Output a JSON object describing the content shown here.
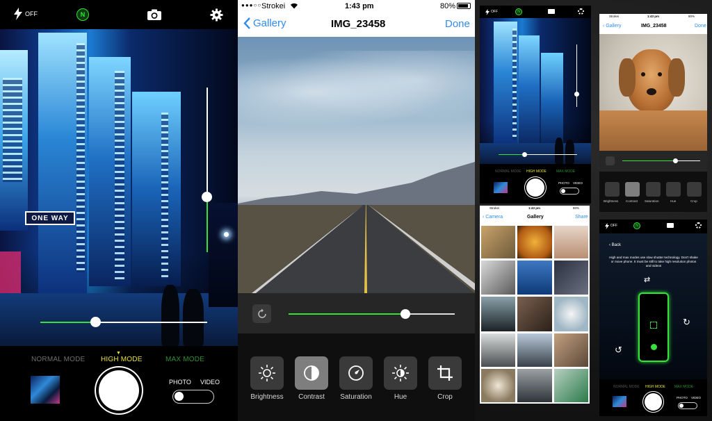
{
  "camera": {
    "flash_label": "OFF",
    "n_badge": "N",
    "modes": [
      "NORMAL MODE",
      "HIGH MODE",
      "MAX MODE"
    ],
    "active_mode": "HIGH MODE",
    "photo_label": "PHOTO",
    "video_label": "VIDEO",
    "street_sign": "ONE WAY",
    "exposure_level": 0.7,
    "shutter_speed_level": 0.29,
    "colors": {
      "accent_green": "#37e23a",
      "active_mode": "#e8e23a"
    }
  },
  "editor": {
    "status": {
      "carrier": "Strokei",
      "time": "1:43 pm",
      "battery": "80%"
    },
    "nav": {
      "back_label": "Gallery",
      "title": "IMG_23458",
      "done_label": "Done"
    },
    "slider_level": 0.74,
    "tools": [
      {
        "label": "Brightness",
        "icon": "brightness-icon"
      },
      {
        "label": "Contrast",
        "icon": "contrast-icon"
      },
      {
        "label": "Saturation",
        "icon": "saturation-icon"
      },
      {
        "label": "Hue",
        "icon": "hue-icon"
      },
      {
        "label": "Crop",
        "icon": "crop-icon"
      }
    ],
    "selected_tool": "Contrast",
    "colors": {
      "accent_green": "#37e23a",
      "link_blue": "#2f8cf0"
    }
  },
  "mini_camera": {
    "flash_label": "OFF",
    "n_badge": "N",
    "modes": [
      "NORMAL MODE",
      "HIGH MODE",
      "MAX MODE"
    ],
    "photo_label": "PHOTO",
    "video_label": "VIDEO"
  },
  "mini_editor": {
    "status": {
      "carrier": "Strokei",
      "time": "1:43 pm",
      "battery": "80%"
    },
    "nav": {
      "back_label": "Gallery",
      "title": "IMG_23458",
      "done_label": "Done"
    },
    "tools": [
      "Brightness",
      "Contrast",
      "Saturation",
      "Hue",
      "Crop"
    ]
  },
  "mini_gallery": {
    "status": {
      "carrier": "Strokei",
      "time": "1:43 pm",
      "battery": "80%"
    },
    "nav": {
      "back_label": "Camera",
      "title": "Gallery",
      "share_label": "Share"
    }
  },
  "mini_help": {
    "flash_label": "OFF",
    "n_badge": "N",
    "back_label": "Back",
    "message": "High and max modes use slow shutter technology. Don't shake or move phone. It must be still to take high resolution photos and videos",
    "modes": [
      "NORMAL MODE",
      "HIGH MODE",
      "MAX MODE"
    ],
    "photo_label": "PHOTO",
    "video_label": "VIDEO"
  }
}
